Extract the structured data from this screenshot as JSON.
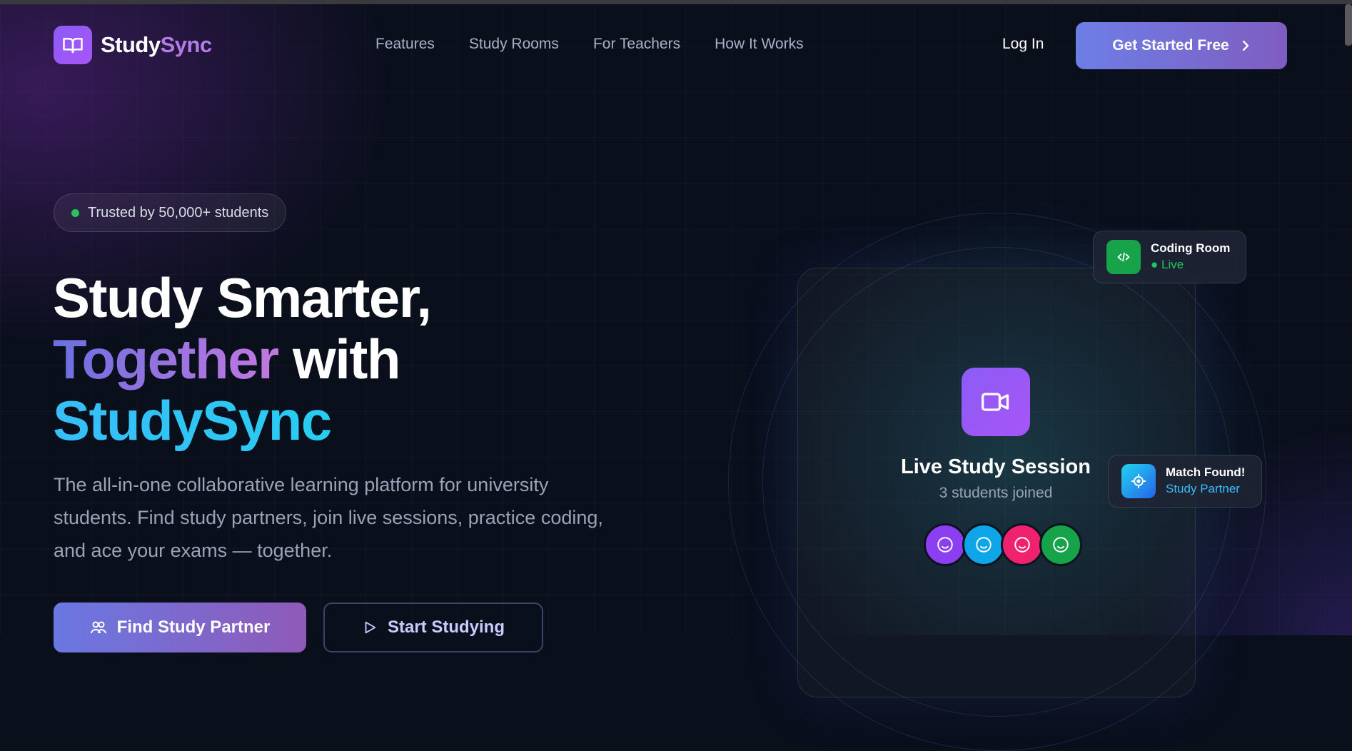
{
  "brand": {
    "name_part1": "Study",
    "name_part2": "Sync",
    "logo_icon": "book-open-icon"
  },
  "nav": {
    "links": [
      "Features",
      "Study Rooms",
      "For Teachers",
      "How It Works"
    ],
    "login_label": "Log In",
    "cta_label": "Get Started Free",
    "cta_icon": "chevron-right-icon"
  },
  "hero": {
    "badge_text": "Trusted by 50,000+ students",
    "headline_line1": "Study Smarter,",
    "headline_highlight": "Together",
    "headline_with": " with",
    "headline_line3": "StudySync",
    "subtitle": "The all-in-one collaborative learning platform for university students. Find study partners, join live sessions, practice coding, and ace your exams — together.",
    "primary_button": "Find Study Partner",
    "secondary_button": "Start Studying"
  },
  "session_card": {
    "title": "Live Study Session",
    "subtitle": "3 students joined",
    "icon": "video-camera-icon",
    "avatars": [
      {
        "icon": "smiley-icon",
        "color": "#8b3ff0"
      },
      {
        "icon": "smiley-icon",
        "color": "#0ea5e9"
      },
      {
        "icon": "smiley-icon",
        "color": "#f0226e"
      },
      {
        "icon": "smiley-icon",
        "color": "#16a34a"
      }
    ]
  },
  "floating": {
    "coding": {
      "title": "Coding Room",
      "status": "● Live",
      "icon": "code-icon"
    },
    "match": {
      "title": "Match Found!",
      "status": "Study Partner",
      "icon": "target-icon"
    }
  },
  "colors": {
    "accent_purple": "#8b5cf6",
    "accent_cyan": "#22d3ee",
    "live_green": "#22c55e",
    "background": "#0a0f1c"
  }
}
